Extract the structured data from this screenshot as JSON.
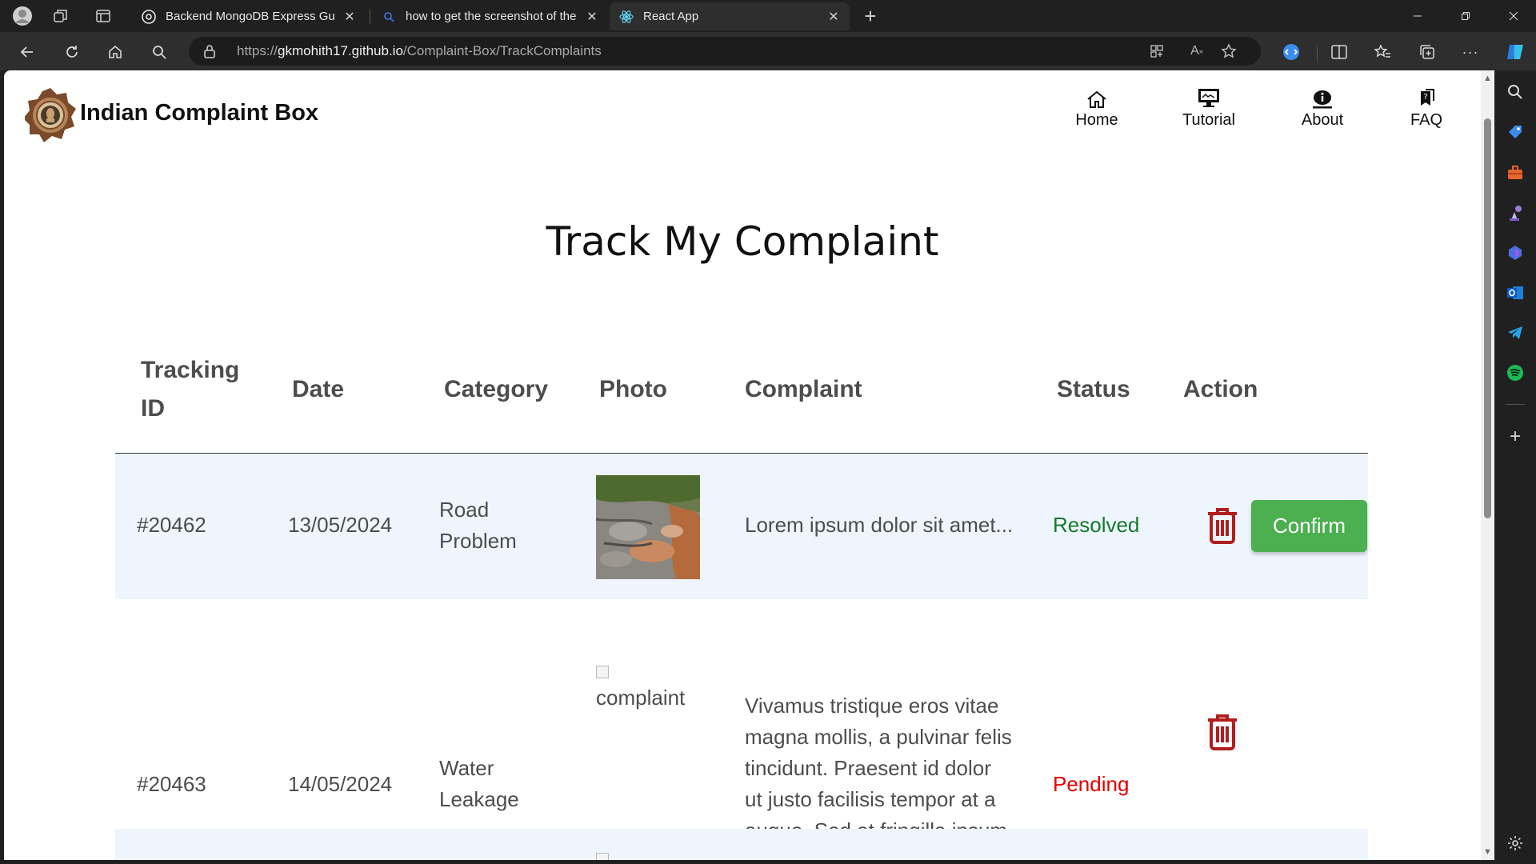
{
  "browser": {
    "tabs": [
      {
        "title": "Backend MongoDB Express Guid",
        "active": false
      },
      {
        "title": "how to get the screenshot of the",
        "active": false
      },
      {
        "title": "React App",
        "active": true
      }
    ],
    "url_prefix": "https://",
    "url_host": "gkmohith17.github.io",
    "url_path": "/Complaint-Box/TrackComplaints"
  },
  "site": {
    "brand": "Indian Complaint Box",
    "nav": [
      {
        "label": "Home",
        "icon": "home-icon"
      },
      {
        "label": "Tutorial",
        "icon": "monitor-icon"
      },
      {
        "label": "About",
        "icon": "info-icon"
      },
      {
        "label": "FAQ",
        "icon": "faq-icon"
      }
    ]
  },
  "page": {
    "title": "Track My Complaint",
    "columns": {
      "tracking_line1": "Tracking",
      "tracking_line2": "ID",
      "date": "Date",
      "category": "Category",
      "photo": "Photo",
      "complaint": "Complaint",
      "status": "Status",
      "action": "Action"
    },
    "rows": [
      {
        "tracking_id": "#20462",
        "date": "13/05/2024",
        "category_line1": "Road",
        "category_line2": "Problem",
        "complaint": "Lorem ipsum dolor sit amet...",
        "status": "Resolved",
        "status_color": "#157a2a",
        "confirm_label": "Confirm"
      },
      {
        "tracking_id": "#20463",
        "date": "14/05/2024",
        "category_line1": "Water",
        "category_line2": "Leakage",
        "photo_alt": "complaint",
        "complaint_lines": [
          "Vivamus tristique eros vitae",
          "magna mollis, a pulvinar felis",
          "tincidunt. Praesent id dolor",
          "ut justo facilisis tempor at a",
          "augue. Sed at fringilla ipsum",
          "..."
        ],
        "status": "Pending",
        "status_color": "#e60000"
      }
    ]
  },
  "colors": {
    "confirm_button": "#4caf50",
    "row_highlight": "#eef5fd",
    "trash_icon": "#b01e1e"
  }
}
